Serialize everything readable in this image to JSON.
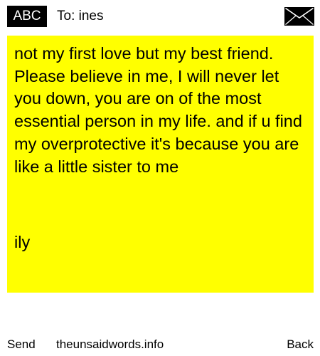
{
  "header": {
    "badge_label": "ABC",
    "recipient_label": "To: ines",
    "icon": "envelope-icon"
  },
  "message": {
    "body": "not my first love but my best friend. Please believe in me, I will never let you down, you are on of the most essential person in my life. and if u find my overprotective it's because you are like a little sister to me",
    "signoff": "ily",
    "background_color": "#ffff00"
  },
  "footer": {
    "send_label": "Send",
    "site_label": "theunsaidwords.info",
    "back_label": "Back"
  }
}
